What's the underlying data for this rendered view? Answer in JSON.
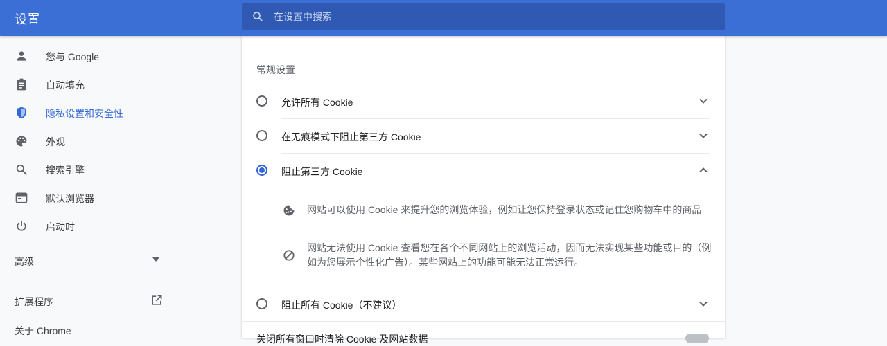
{
  "header": {
    "title": "设置",
    "search_placeholder": "在设置中搜索"
  },
  "sidebar": {
    "items": [
      {
        "label": "您与 Google",
        "icon": "person-icon"
      },
      {
        "label": "自动填充",
        "icon": "clipboard-icon"
      },
      {
        "label": "隐私设置和安全性",
        "icon": "shield-icon",
        "active": true
      },
      {
        "label": "外观",
        "icon": "palette-icon"
      },
      {
        "label": "搜索引擎",
        "icon": "search-icon"
      },
      {
        "label": "默认浏览器",
        "icon": "browser-icon"
      },
      {
        "label": "启动时",
        "icon": "power-icon"
      }
    ],
    "advanced_label": "高级",
    "extensions_label": "扩展程序",
    "about_label": "关于 Chrome"
  },
  "cookies": {
    "section_title": "常规设置",
    "options": [
      {
        "label": "允许所有 Cookie",
        "selected": false,
        "expanded": false
      },
      {
        "label": "在无痕模式下阻止第三方 Cookie",
        "selected": false,
        "expanded": false
      },
      {
        "label": "阻止第三方 Cookie",
        "selected": true,
        "expanded": true
      },
      {
        "label": "阻止所有 Cookie（不建议）",
        "selected": false,
        "expanded": false
      }
    ],
    "details": [
      {
        "icon": "cookie-icon",
        "text": "网站可以使用 Cookie 来提升您的浏览体验，例如让您保持登录状态或记住您购物车中的商品"
      },
      {
        "icon": "block-icon",
        "text": "网站无法使用 Cookie 查看您在各个不同网站上的浏览活动，因而无法实现某些功能或目的（例如为您展示个性化广告）。某些网站上的功能可能无法正常运行。"
      }
    ],
    "bottom_label": "关闭所有窗口时清除 Cookie 及网站数据",
    "bottom_toggle_on": false
  },
  "colors": {
    "header_blue": "#3b6fd6",
    "search_blue": "#2f59b2",
    "accent": "#3367d6"
  }
}
